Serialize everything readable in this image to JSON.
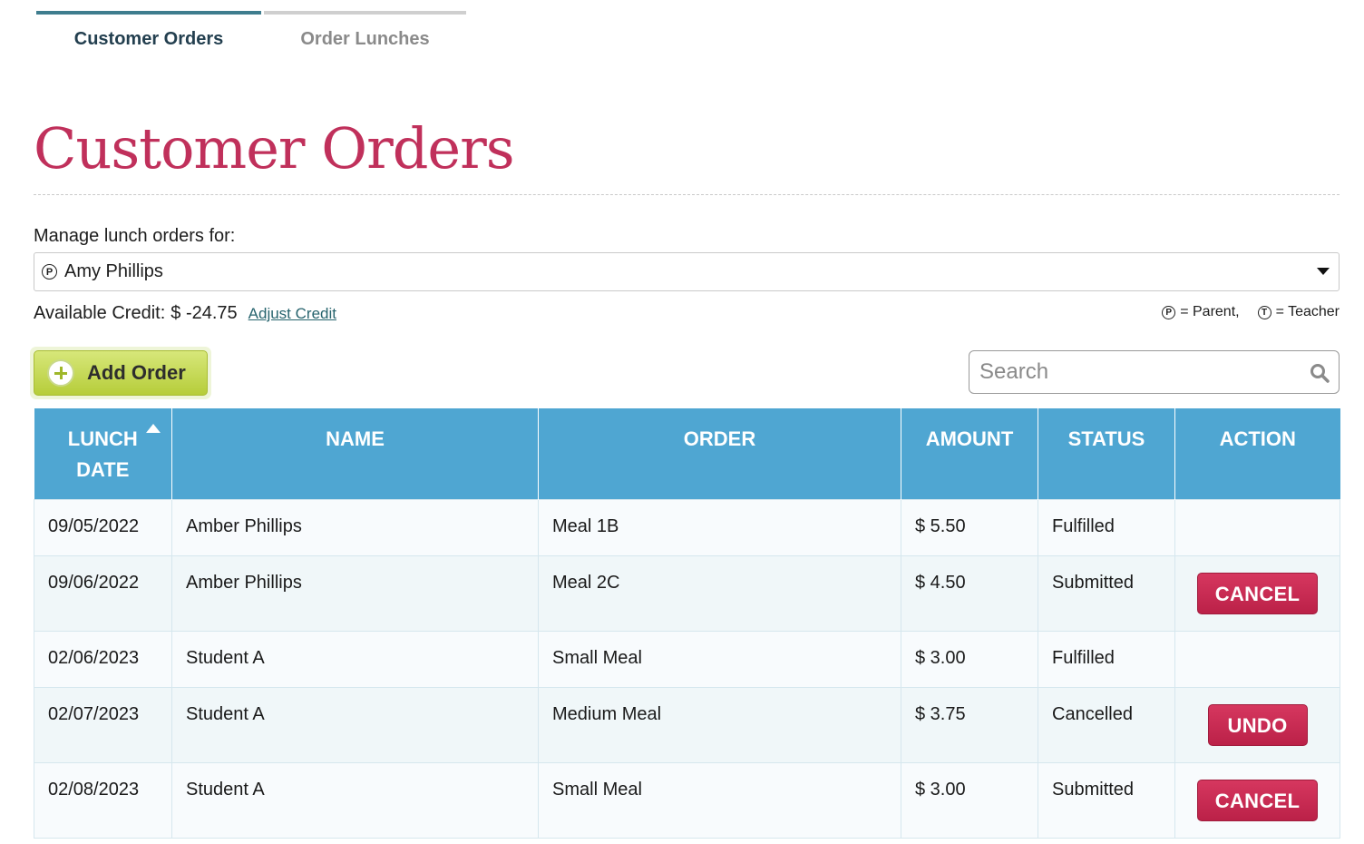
{
  "tabs": [
    {
      "label": "Customer Orders"
    },
    {
      "label": "Order Lunches"
    }
  ],
  "page_title": "Customer Orders",
  "manage": {
    "label": "Manage lunch orders for:",
    "selected_role_symbol": "P",
    "selected_customer": "Amy Phillips"
  },
  "credit": {
    "label": "Available Credit:",
    "amount": "$ -24.75",
    "adjust_link": "Adjust Credit"
  },
  "legend": {
    "parent_symbol": "P",
    "parent_text": "= Parent,",
    "teacher_symbol": "T",
    "teacher_text": "= Teacher"
  },
  "add_order_label": "Add Order",
  "search": {
    "placeholder": "Search"
  },
  "table": {
    "headers": {
      "lunch_date_line1": "LUNCH",
      "lunch_date_line2": "DATE",
      "name": "NAME",
      "order": "ORDER",
      "amount": "AMOUNT",
      "status": "STATUS",
      "action": "ACTION"
    },
    "rows": [
      {
        "date": "09/05/2022",
        "name": "Amber Phillips",
        "order": "Meal 1B",
        "amount": "$ 5.50",
        "status": "Fulfilled",
        "action": ""
      },
      {
        "date": "09/06/2022",
        "name": "Amber Phillips",
        "order": "Meal 2C",
        "amount": "$ 4.50",
        "status": "Submitted",
        "action": "CANCEL"
      },
      {
        "date": "02/06/2023",
        "name": "Student A",
        "order": "Small Meal",
        "amount": "$ 3.00",
        "status": "Fulfilled",
        "action": ""
      },
      {
        "date": "02/07/2023",
        "name": "Student A",
        "order": "Medium Meal",
        "amount": "$ 3.75",
        "status": "Cancelled",
        "action": "UNDO"
      },
      {
        "date": "02/08/2023",
        "name": "Student A",
        "order": "Small Meal",
        "amount": "$ 3.00",
        "status": "Submitted",
        "action": "CANCEL"
      }
    ]
  },
  "colors": {
    "title": "#c0305b",
    "table_header": "#4fa6d2",
    "action_button": "#c92a52",
    "add_order": "#c3d84f",
    "active_tab": "#3e7d8e"
  }
}
